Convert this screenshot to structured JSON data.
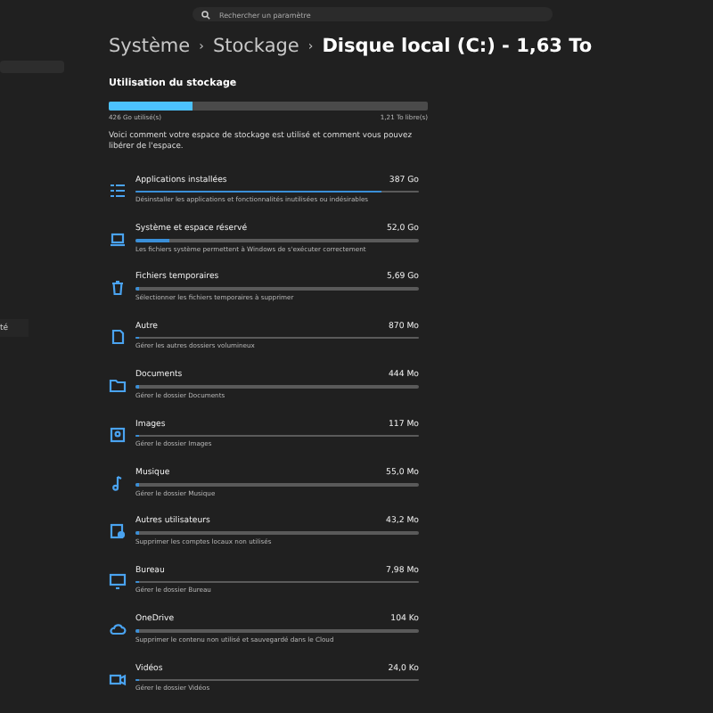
{
  "search": {
    "placeholder": "Rechercher un paramètre"
  },
  "sidebar": {
    "items": [
      {
        "label": "té"
      }
    ]
  },
  "breadcrumb": [
    "Système",
    "›",
    "Stockage",
    "›",
    "Disque local (C:) - 1,63 To"
  ],
  "section_title": "Utilisation du stockage",
  "usage": {
    "level": 0.26,
    "used": "426 Go utilisé(s)",
    "free": "1,21 To libre(s)"
  },
  "description": "Voici comment votre espace de stockage est utilisé et comment vous pouvez libérer de l'espace.",
  "categories": [
    {
      "kind": "apps",
      "name": "Applications installées",
      "size": "387 Go",
      "level": 0.87,
      "hint": "Désinstaller les applications et fonctionnalités inutilisées ou indésirables"
    },
    {
      "kind": "system",
      "name": "Système et espace réservé",
      "size": "52,0 Go",
      "level": 0.12,
      "hint": "Les fichiers système permettent à Windows de s'exécuter correctement"
    },
    {
      "kind": "temp",
      "name": "Fichiers temporaires",
      "size": "5,69 Go",
      "level": 0.015,
      "hint": "Sélectionner les fichiers temporaires à supprimer"
    },
    {
      "kind": "other",
      "name": "Autre",
      "size": "870 Mo",
      "level": 0.003,
      "hint": "Gérer les autres dossiers volumineux"
    },
    {
      "kind": "documents",
      "name": "Documents",
      "size": "444 Mo",
      "level": 0.002,
      "hint": "Gérer le dossier Documents"
    },
    {
      "kind": "images",
      "name": "Images",
      "size": "117 Mo",
      "level": 0.001,
      "hint": "Gérer le dossier Images"
    },
    {
      "kind": "music",
      "name": "Musique",
      "size": "55,0 Mo",
      "level": 0.009,
      "hint": "Gérer le dossier Musique"
    },
    {
      "kind": "users",
      "name": "Autres utilisateurs",
      "size": "43,2 Mo",
      "level": 0.009,
      "hint": "Supprimer les comptes locaux non utilisés"
    },
    {
      "kind": "desktop",
      "name": "Bureau",
      "size": "7,98 Mo",
      "level": 0.009,
      "hint": "Gérer le dossier Bureau"
    },
    {
      "kind": "cloud",
      "name": "OneDrive",
      "size": "104 Ko",
      "level": 0.009,
      "hint": "Supprimer le contenu non utilisé et sauvegardé dans le Cloud"
    },
    {
      "kind": "videos",
      "name": "Vidéos",
      "size": "24,0 Ko",
      "level": 0.009,
      "hint": "Gérer le dossier Vidéos"
    }
  ]
}
